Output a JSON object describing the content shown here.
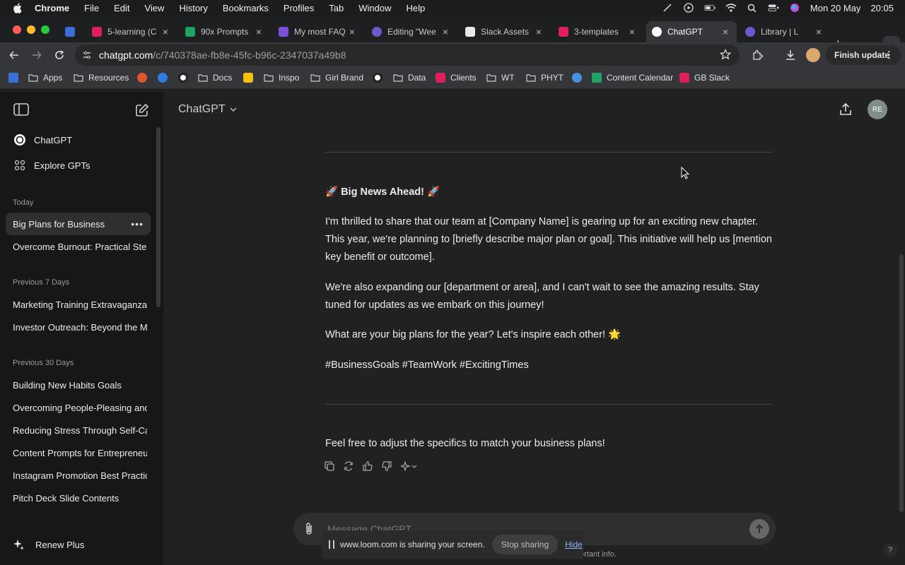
{
  "menubar": {
    "items": [
      "Chrome",
      "File",
      "Edit",
      "View",
      "History",
      "Bookmarks",
      "Profiles",
      "Tab",
      "Window",
      "Help"
    ],
    "date": "Mon 20 May",
    "time": "20:05"
  },
  "tabs": [
    {
      "label": "5-learning (C",
      "color": "#3b6fd8"
    },
    {
      "label": "90x Prompts",
      "color": "#1ea362"
    },
    {
      "label": "My most FAQ",
      "color": "#7b4fd6"
    },
    {
      "label": "Editing \"Wee",
      "color": "#6a5acd"
    },
    {
      "label": "Slack Assets",
      "color": "#e8e8e8"
    },
    {
      "label": "3-templates",
      "color": "#e01e5a"
    },
    {
      "label": "ChatGPT",
      "color": "#ffffff"
    },
    {
      "label": "Library | L",
      "color": "#6e56cf"
    }
  ],
  "address": {
    "host": "chatgpt.com",
    "path": "/c/740378ae-fb8e-45fc-b96c-2347037a49b8"
  },
  "toolbar": {
    "finish_update": "Finish update"
  },
  "bookmarks": [
    {
      "label": "Apps"
    },
    {
      "label": "Resources"
    },
    {
      "label": "Docs"
    },
    {
      "label": "Inspo"
    },
    {
      "label": "Girl Brand"
    },
    {
      "label": "Data"
    },
    {
      "label": "Clients"
    },
    {
      "label": "WT"
    },
    {
      "label": "PHYT"
    },
    {
      "label": "Content Calendar"
    },
    {
      "label": "GB Slack"
    }
  ],
  "sidebar": {
    "chatgpt": "ChatGPT",
    "explore": "Explore GPTs",
    "today_label": "Today",
    "today": [
      "Big Plans for Business",
      "Overcome Burnout: Practical Step"
    ],
    "prev7_label": "Previous 7 Days",
    "prev7": [
      "Marketing Training Extravaganza",
      "Investor Outreach: Beyond the Ma"
    ],
    "prev30_label": "Previous 30 Days",
    "prev30": [
      "Building New Habits Goals",
      "Overcoming People-Pleasing and",
      "Reducing Stress Through Self-Car",
      "Content Prompts for Entrepreneu",
      "Instagram Promotion Best Practic",
      "Pitch Deck Slide Contents"
    ],
    "renew": "Renew Plus"
  },
  "main": {
    "title": "ChatGPT",
    "avatar": "RE",
    "headline": "🚀 Big News Ahead! 🚀",
    "p1": "I'm thrilled to share that our team at [Company Name] is gearing up for an exciting new chapter. This year, we're planning to [briefly describe major plan or goal]. This initiative will help us [mention key benefit or outcome].",
    "p2": "We're also expanding our [department or area], and I can't wait to see the amazing results. Stay tuned for updates as we embark on this journey!",
    "p3": "What are your big plans for the year? Let's inspire each other! 🌟",
    "hashtags": "#BusinessGoals #TeamWork #ExcitingTimes",
    "closing": "Feel free to adjust the specifics to match your business plans!",
    "placeholder": "Message ChatGPT",
    "footnote": "ortant info."
  },
  "loom": {
    "text": "www.loom.com is sharing your screen.",
    "stop": "Stop sharing",
    "hide": "Hide"
  },
  "help": "?"
}
